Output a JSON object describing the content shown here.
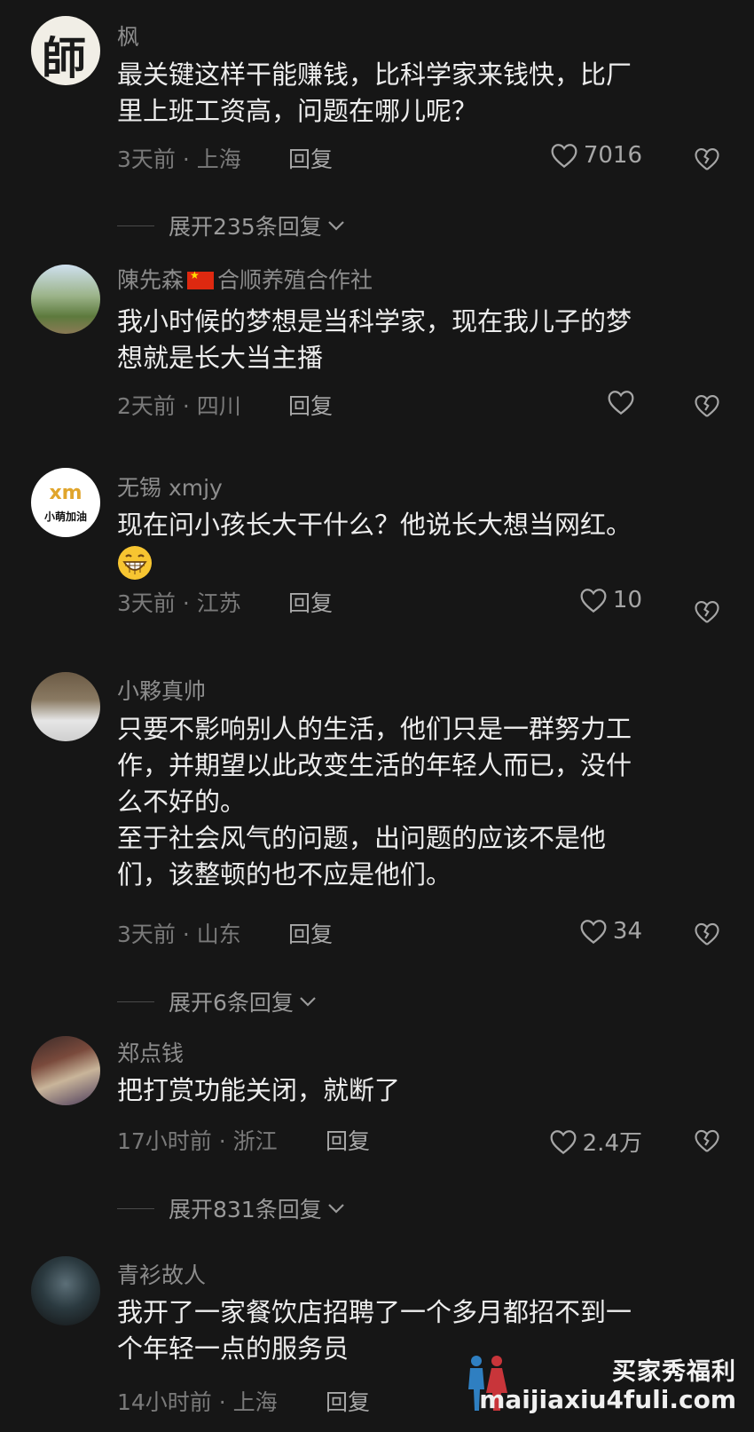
{
  "comments": [
    {
      "name": "枫",
      "text_lines": [
        "最关键这样干能赚钱，比科学家来钱快，比厂",
        "里上班工资高，问题在哪儿呢？"
      ],
      "time_location": "3天前 · 上海",
      "reply_label": "回复",
      "likes": "7016",
      "expand": "展开235条回复"
    },
    {
      "name": "陳先森",
      "name_suffix": "合顺养殖合作社",
      "text_lines": [
        "我小时候的梦想是当科学家，现在我儿子的梦",
        "想就是长大当主播"
      ],
      "time_location": "2天前 · 四川",
      "reply_label": "回复",
      "likes": ""
    },
    {
      "name": "无锡 xmjy",
      "avatar_text": "小萌加油",
      "avatar_logo": "xm",
      "text_lines": [
        "现在问小孩长大干什么？他说长大想当网红。"
      ],
      "time_location": "3天前 · 江苏",
      "reply_label": "回复",
      "likes": "10"
    },
    {
      "name": "小夥真帅",
      "text_lines": [
        "只要不影响别人的生活，他们只是一群努力工",
        "作，并期望以此改变生活的年轻人而已，没什",
        "么不好的。",
        "至于社会风气的问题，出问题的应该不是他",
        "们，该整顿的也不应是他们。"
      ],
      "time_location": "3天前 · 山东",
      "reply_label": "回复",
      "likes": "34",
      "expand": "展开6条回复"
    },
    {
      "name": "郑点钱",
      "text_lines": [
        "把打赏功能关闭，就断了"
      ],
      "time_location": "17小时前 · 浙江",
      "reply_label": "回复",
      "likes": "2.4万",
      "expand": "展开831条回复"
    },
    {
      "name": "青衫故人",
      "text_lines": [
        "我开了一家餐饮店招聘了一个多月都招不到一",
        "个年轻一点的服务员"
      ],
      "time_location": "14小时前 · 上海",
      "reply_label": "回复",
      "likes": ""
    }
  ],
  "avatar1_text": "師",
  "watermark": {
    "title": "买家秀福利",
    "url": "maijiaxiu4fuli.com"
  },
  "colors": {
    "background": "#161616",
    "flag": "#de2910"
  }
}
